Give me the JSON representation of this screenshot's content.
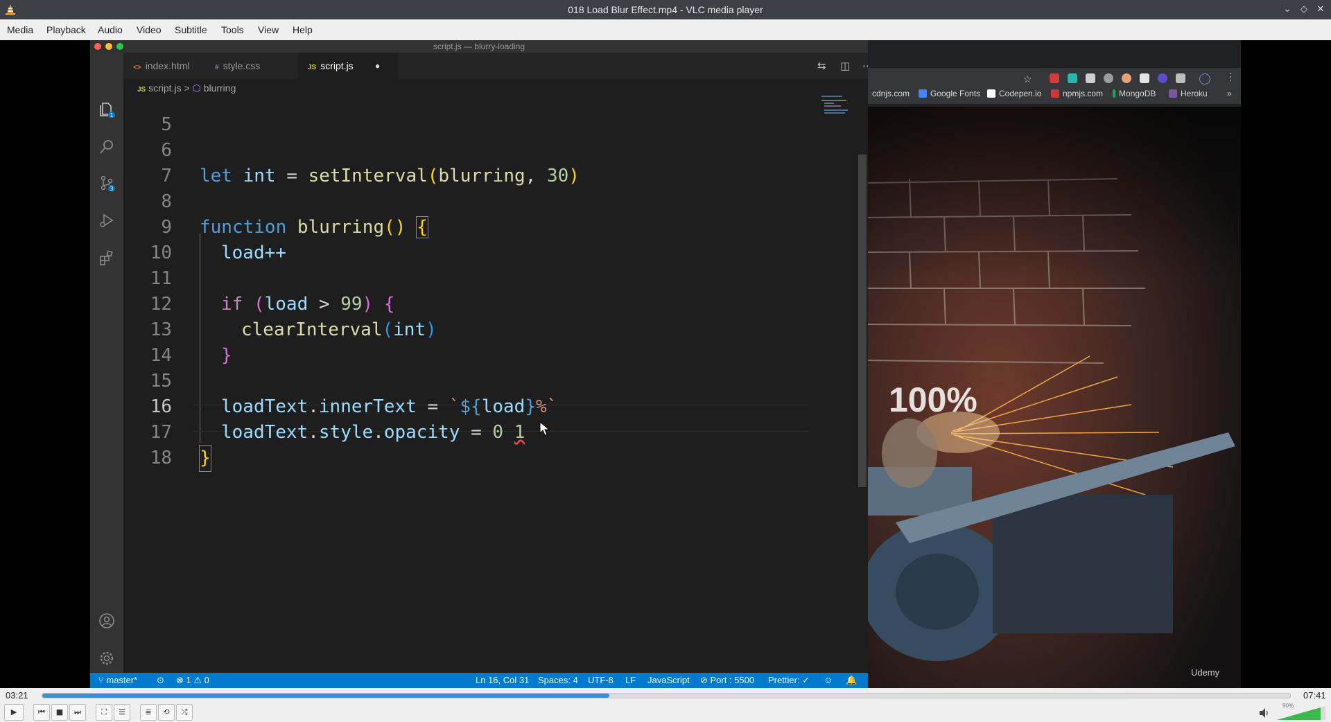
{
  "vlc": {
    "title": "018 Load Blur Effect.mp4 - VLC media player",
    "menu": [
      "Media",
      "Playback",
      "Audio",
      "Video",
      "Subtitle",
      "Tools",
      "View",
      "Help"
    ],
    "time_elapsed": "03:21",
    "time_total": "07:41",
    "progress": 0.4544,
    "volume_label": "90%",
    "volume": 0.9
  },
  "editor": {
    "window_title": "script.js — blurry-loading",
    "tabs": [
      {
        "icon": "<>",
        "label": "index.html"
      },
      {
        "icon": "#",
        "label": "style.css"
      },
      {
        "icon": "JS",
        "label": "script.js",
        "modified": "●"
      }
    ],
    "breadcrumb": {
      "file": "script.js",
      "separator": ">",
      "symbol": "blurring"
    },
    "activity_badges": {
      "explorer": "1",
      "source_control": "3"
    },
    "line_numbers": [
      "5",
      "6",
      "7",
      "8",
      "9",
      "10",
      "11",
      "12",
      "13",
      "14",
      "15",
      "16",
      "17",
      "18"
    ],
    "code": {
      "l6": {
        "kw": "let",
        "name": "int",
        "eq": "=",
        "fn": "setInterval",
        "open": "(",
        "arg": "blurring",
        "comma": ",",
        "num": "30",
        "close": ")"
      },
      "l8": {
        "kw": "function",
        "fn": "blurring",
        "parens": "()",
        "brace": "{"
      },
      "l9": {
        "text": "load++"
      },
      "l11": {
        "kw": "if",
        "open": "(",
        "cond_var": "load",
        "op": ">",
        "num": "99",
        "close": ")",
        "brace": "{"
      },
      "l12": {
        "fn": "clearInterval",
        "open": "(",
        "arg": "int",
        "close": ")"
      },
      "l13": {
        "brace": "}"
      },
      "l15": {
        "obj": "loadText",
        "dot": ".",
        "prop": "innerText",
        "eq": "=",
        "tick": "`",
        "interp_open": "${",
        "var": "load",
        "interp_close": "}",
        "pct": "%",
        "tick_close": "`"
      },
      "l16": {
        "obj": "loadText",
        "dot1": ".",
        "prop1": "style",
        "dot2": ".",
        "prop2": "opacity",
        "eq": "=",
        "num": "0",
        "num2": "1"
      },
      "l17": {
        "brace": "}"
      }
    },
    "status": {
      "branch": "master*",
      "errors": "1",
      "warnings": "0",
      "cursor": "Ln 16, Col 31",
      "spaces": "Spaces: 4",
      "encoding": "UTF-8",
      "eol": "LF",
      "language": "JavaScript",
      "port": "Port : 5500",
      "prettier": "Prettier: ✓"
    }
  },
  "browser": {
    "bookmarks": [
      "cdnjs.com",
      "Google Fonts",
      "Codepen.io",
      "npmjs.com",
      "MongoDB",
      "Heroku"
    ],
    "more": "»",
    "overlay_text": "100%",
    "watermark": "Udemy"
  },
  "colors": {
    "vscode_blue": "#007acc",
    "seek_fill": "#3b8ed8",
    "vlc_orange": "#f28c1c"
  }
}
